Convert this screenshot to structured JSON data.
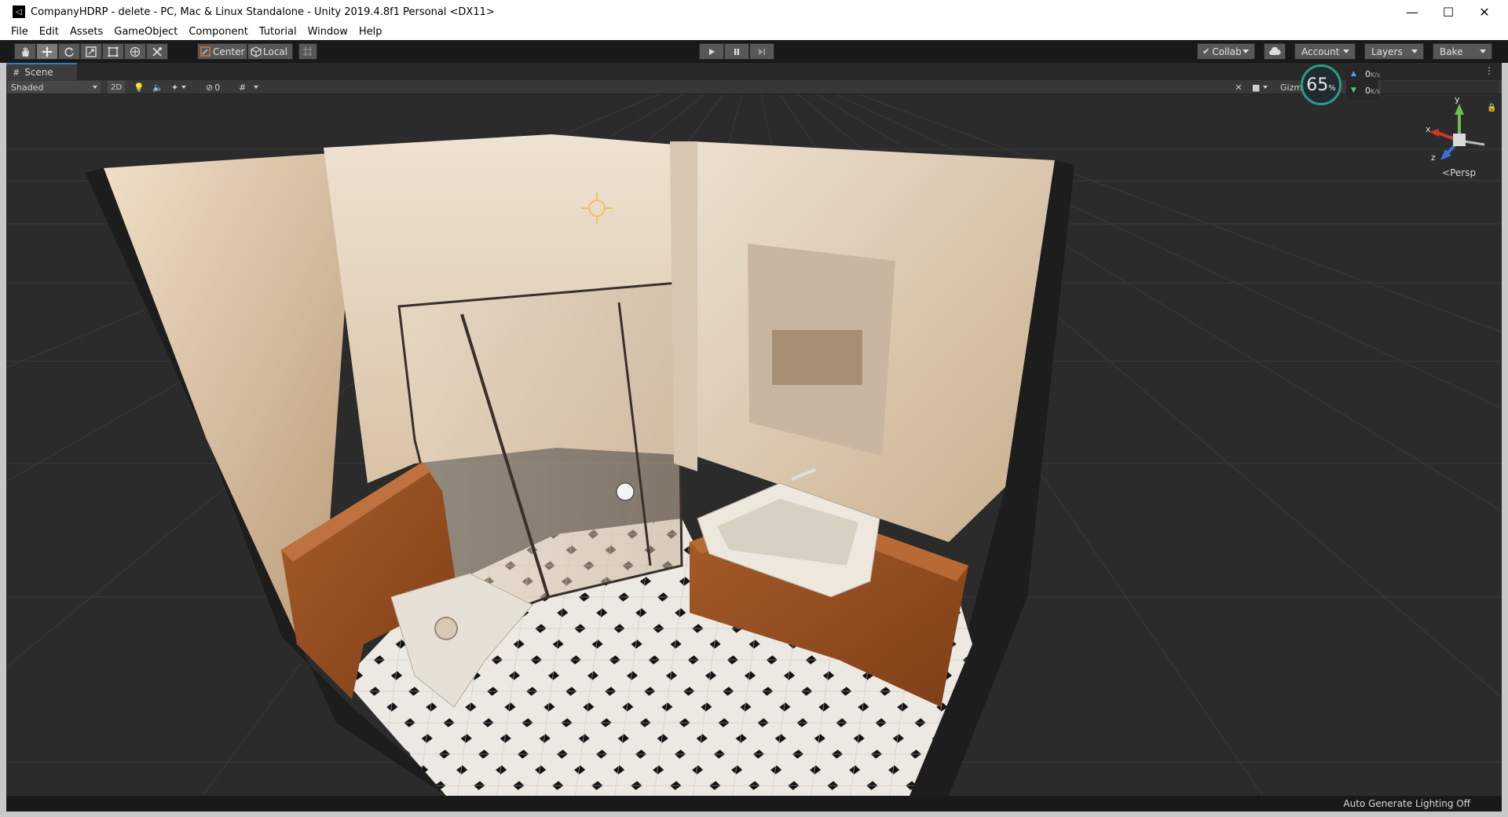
{
  "window": {
    "title": "CompanyHDRP - delete - PC, Mac & Linux Standalone - Unity 2019.4.8f1 Personal <DX11>",
    "controls": [
      "—",
      "☐",
      "✕"
    ]
  },
  "menu": [
    "File",
    "Edit",
    "Assets",
    "GameObject",
    "Component",
    "Tutorial",
    "Window",
    "Help"
  ],
  "toolbar": {
    "pivot_mode": "Center",
    "pivot_rotation": "Local",
    "collab": "Collab",
    "account": "Account",
    "layers": "Layers",
    "layout": "Bake"
  },
  "scene": {
    "tab_label": "Scene",
    "shading_mode": "Shaded",
    "mode_2d": "2D",
    "hidden_count": "0",
    "gizmos_label": "Gizm",
    "projection": "Persp",
    "axis_labels": {
      "x": "x",
      "y": "y",
      "z": "z"
    }
  },
  "fps_widget": {
    "value": "65",
    "unit": "%",
    "upload": "0",
    "download": "0",
    "rate_unit": "K/s"
  },
  "status": {
    "message": "Auto Generate Lighting Off"
  },
  "colors": {
    "editor_dark": "#191919",
    "panel": "#383838",
    "viewport_bg": "#2b2b2b",
    "grid": "#3a3a3a",
    "wall": "#e6d3bd",
    "wood": "#9b5526",
    "accent_fps": "#2e9a86"
  }
}
